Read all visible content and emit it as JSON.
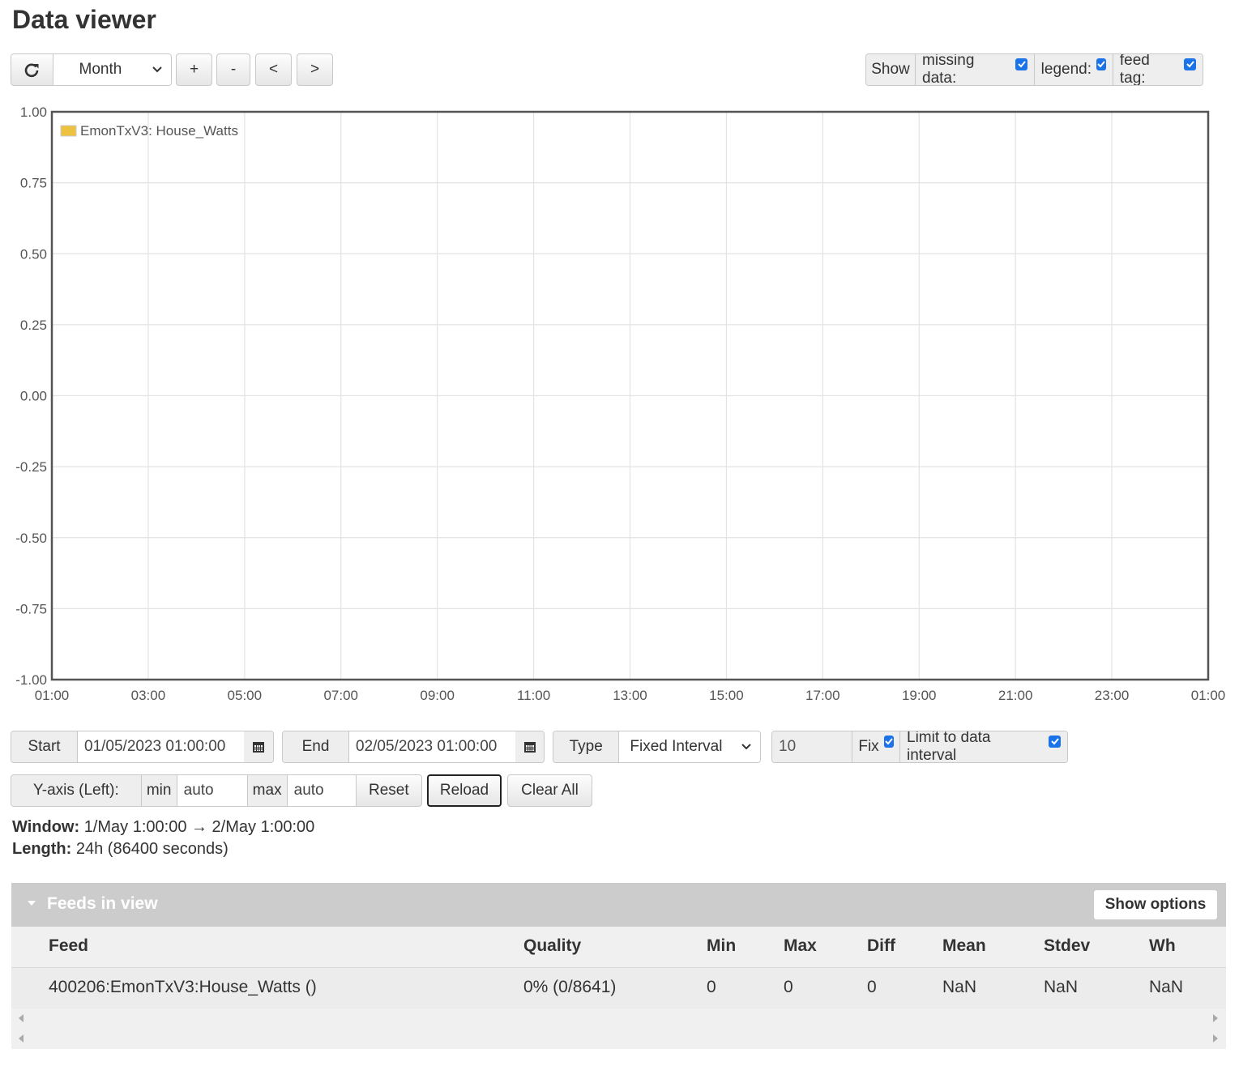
{
  "page": {
    "title": "Data viewer"
  },
  "toolbar": {
    "range_select": "Month",
    "zoom_in": "+",
    "zoom_out": "-",
    "pan_left": "<",
    "pan_right": ">",
    "show_label": "Show",
    "missing_data_label": "missing data:",
    "legend_label": "legend:",
    "feed_tag_label": "feed tag:"
  },
  "chart_data": {
    "type": "line",
    "series": [
      {
        "name": "EmonTxV3: House_Watts",
        "values": [],
        "color": "#edc240"
      }
    ],
    "xticks": [
      "01:00",
      "03:00",
      "05:00",
      "07:00",
      "09:00",
      "11:00",
      "13:00",
      "15:00",
      "17:00",
      "19:00",
      "21:00",
      "23:00",
      "01:00"
    ],
    "yticks": [
      "1.00",
      "0.75",
      "0.50",
      "0.25",
      "0.00",
      "-0.25",
      "-0.50",
      "-0.75",
      "-1.00"
    ],
    "ylim": [
      -1,
      1
    ],
    "grid": true,
    "legend": "top-left"
  },
  "controls": {
    "start_label": "Start",
    "start_value": "01/05/2023 01:00:00",
    "end_label": "End",
    "end_value": "02/05/2023 01:00:00",
    "type_label": "Type",
    "type_value": "Fixed Interval",
    "interval_value": "10",
    "fix_label": "Fix",
    "limit_label": "Limit to data interval",
    "yaxis_label": "Y-axis (Left):",
    "min_label": "min",
    "min_value": "auto",
    "max_label": "max",
    "max_value": "auto",
    "reset": "Reset",
    "reload": "Reload",
    "clear_all": "Clear All"
  },
  "info": {
    "window_label": "Window:",
    "window_value": "1/May 1:00:00 → 2/May 1:00:00",
    "length_label": "Length:",
    "length_value": "24h (86400 seconds)"
  },
  "feeds": {
    "title": "Feeds in view",
    "show_options": "Show options",
    "columns": [
      "Feed",
      "Quality",
      "Min",
      "Max",
      "Diff",
      "Mean",
      "Stdev",
      "Wh"
    ],
    "rows": [
      [
        "400206:EmonTxV3:House_Watts ()",
        "0% (0/8641)",
        "0",
        "0",
        "0",
        "NaN",
        "NaN",
        "NaN"
      ]
    ]
  }
}
